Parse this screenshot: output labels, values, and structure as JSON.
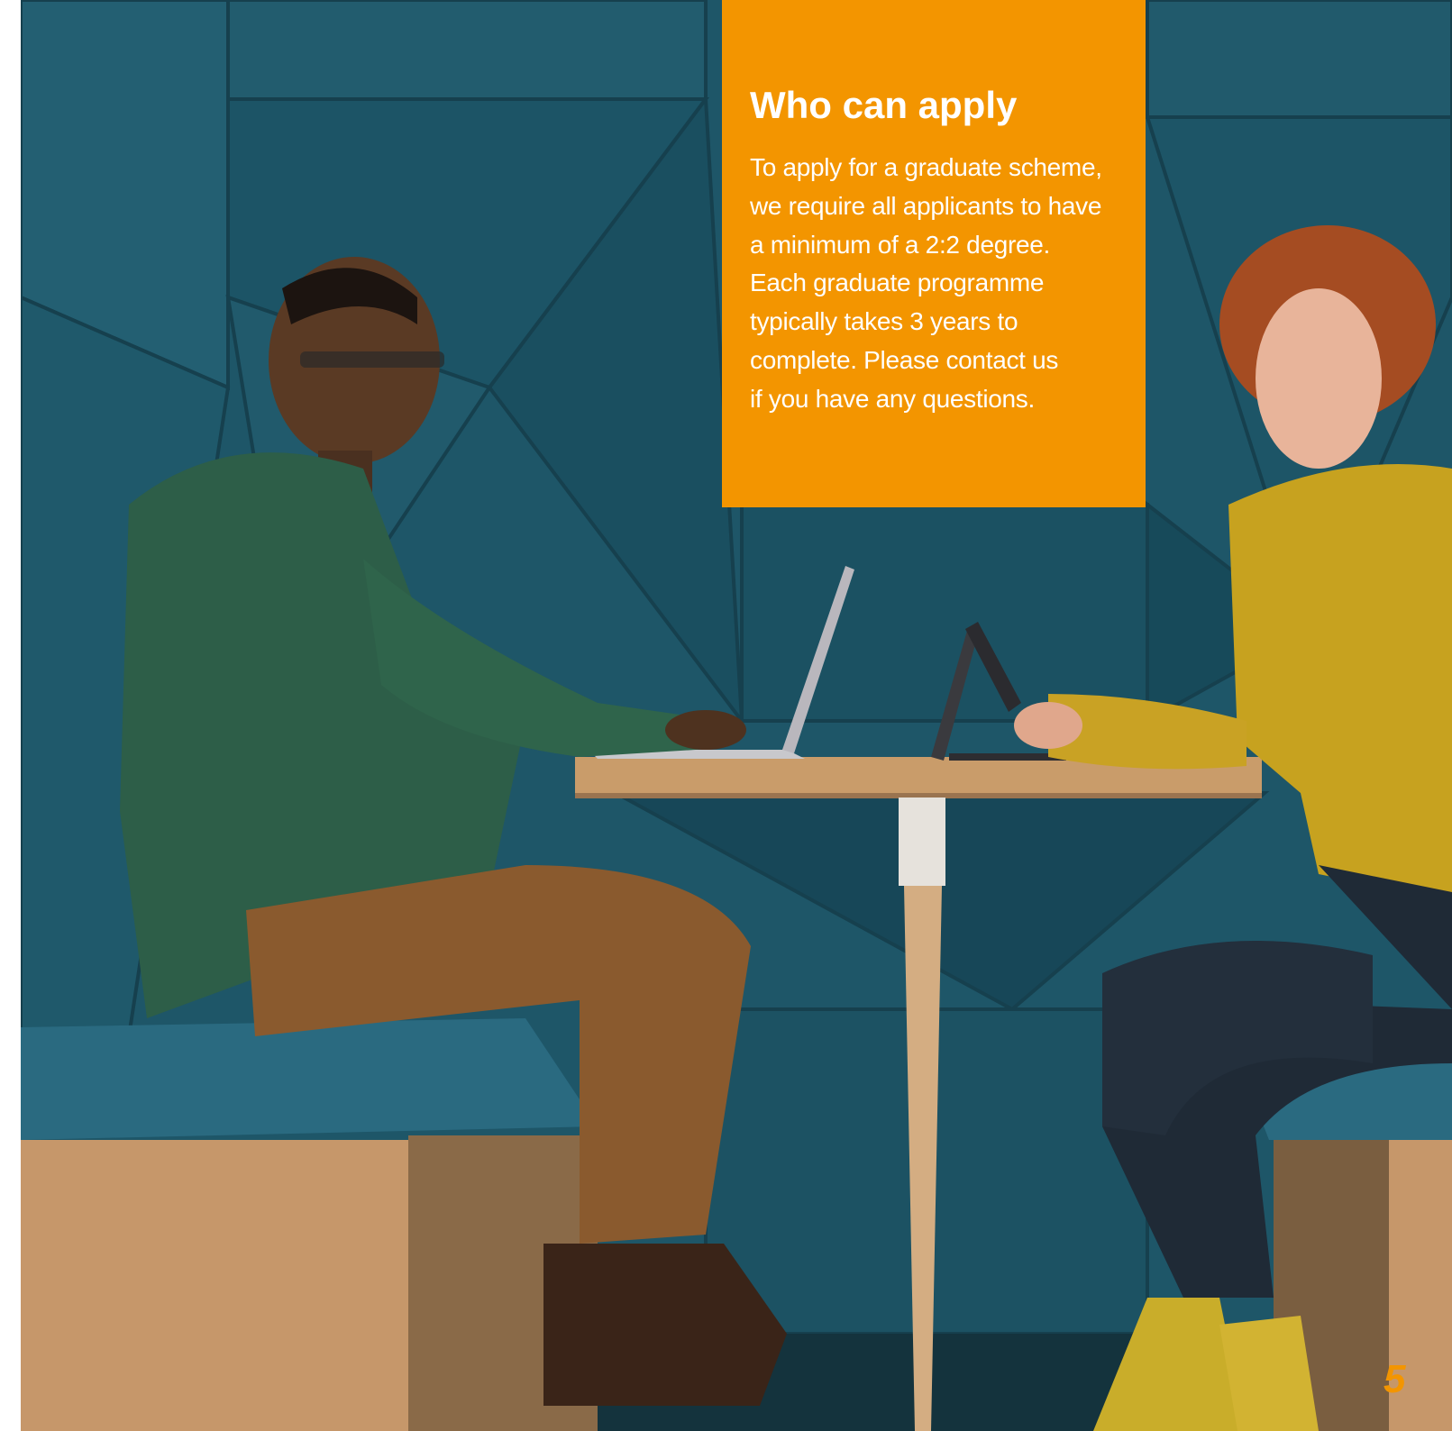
{
  "panel": {
    "title": "Who can apply",
    "body_lines": [
      "To apply for a graduate scheme,",
      "we require all applicants to have",
      "a minimum of a 2:2 degree.",
      "Each graduate programme",
      "typically takes 3 years to",
      "complete. Please contact us",
      "if you have any questions."
    ]
  },
  "page_number": "5",
  "colors": {
    "accent": "#f39500",
    "wall": "#1f5a6b",
    "wood": "#c99c6a",
    "text_on_accent": "#ffffff"
  }
}
